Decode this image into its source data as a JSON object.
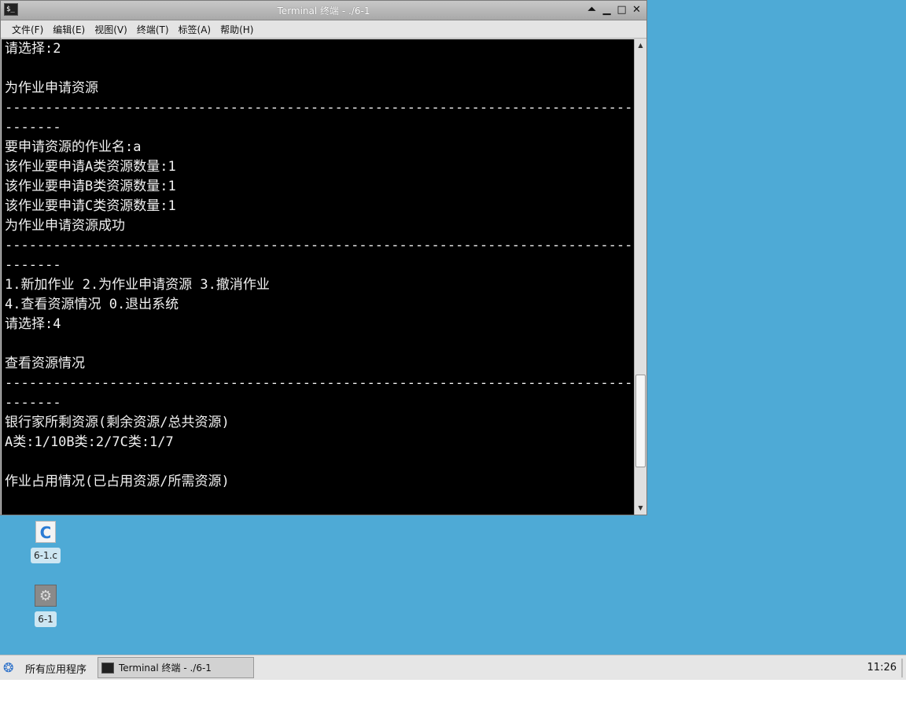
{
  "window": {
    "title": "Terminal 终端 - ./6-1",
    "controls": {
      "shade": "⏶",
      "minimize": "▁",
      "maximize": "□",
      "close": "✕"
    }
  },
  "menubar": {
    "items": [
      "文件(F)",
      "编辑(E)",
      "视图(V)",
      "终端(T)",
      "标签(A)",
      "帮助(H)"
    ]
  },
  "terminal": {
    "lines": [
      "请选择:2",
      "",
      "为作业申请资源",
      "--------------------------------------------------------------------------------",
      "-------",
      "要申请资源的作业名:a",
      "该作业要申请A类资源数量:1",
      "该作业要申请B类资源数量:1",
      "该作业要申请C类资源数量:1",
      "为作业申请资源成功",
      "--------------------------------------------------------------------------------",
      "-------",
      "1.新加作业 2.为作业申请资源 3.撤消作业",
      "4.查看资源情况 0.退出系统",
      "请选择:4",
      "",
      "查看资源情况",
      "--------------------------------------------------------------------------------",
      "-------",
      "银行家所剩资源(剩余资源/总共资源)",
      "A类:1/10B类:2/7C类:1/7",
      "",
      "作业占用情况(已占用资源/所需资源)"
    ]
  },
  "desktop": {
    "icons": [
      {
        "label": "6-1.c",
        "icon": "c-source-file-icon"
      },
      {
        "label": "6-1",
        "icon": "executable-gear-icon"
      }
    ]
  },
  "taskbar": {
    "start_label": "所有应用程序",
    "task_label": "Terminal 终端 - ./6-1",
    "clock": "11:26"
  }
}
